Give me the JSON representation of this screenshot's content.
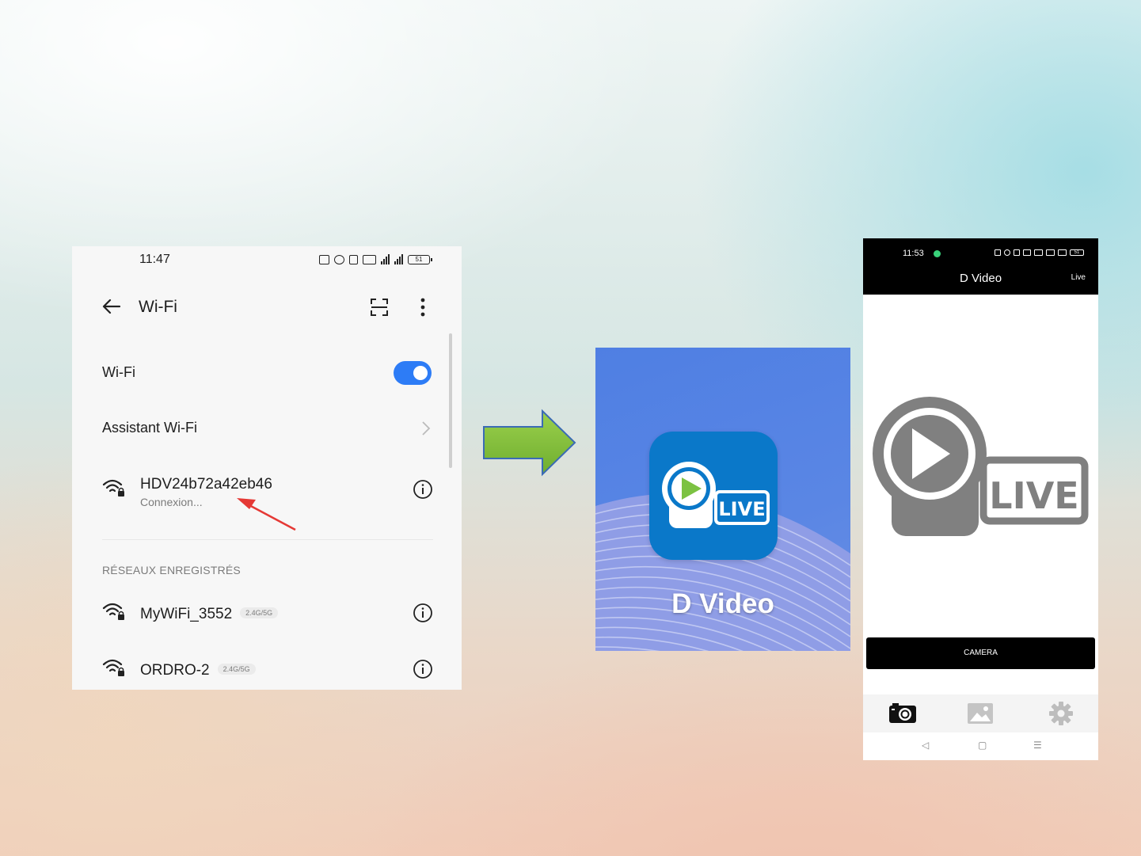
{
  "wifi_screen": {
    "status_time": "11:47",
    "battery": "51",
    "title": "Wi-Fi",
    "wifi_toggle_label": "Wi-Fi",
    "wifi_enabled": true,
    "assistant_label": "Assistant Wi-Fi",
    "current_network": {
      "name": "HDV24b72a42eb46",
      "status": "Connexion..."
    },
    "saved_section_title": "RÉSEAUX ENREGISTRÉS",
    "saved_networks": [
      {
        "name": "MyWiFi_3552",
        "band": "2.4G/5G"
      },
      {
        "name": "ORDRO-2",
        "band": "2.4G/5G"
      }
    ]
  },
  "app_tile": {
    "icon_badge": "LIVE",
    "app_name": "D Video"
  },
  "phone_app": {
    "status_time": "11:53",
    "battery": "51",
    "title": "D Video",
    "live_button": "Live",
    "logo_badge": "LIVE",
    "camera_button": "CAMERA",
    "nav_back": "◁",
    "nav_home": "▢",
    "nav_menu": "☰"
  },
  "colors": {
    "toggle_blue": "#2d7cf6",
    "arrow_green": "#8cc63f",
    "icon_blue": "#0a78c9",
    "tile_blue": "#5a86e4",
    "logo_gray": "#808080"
  }
}
